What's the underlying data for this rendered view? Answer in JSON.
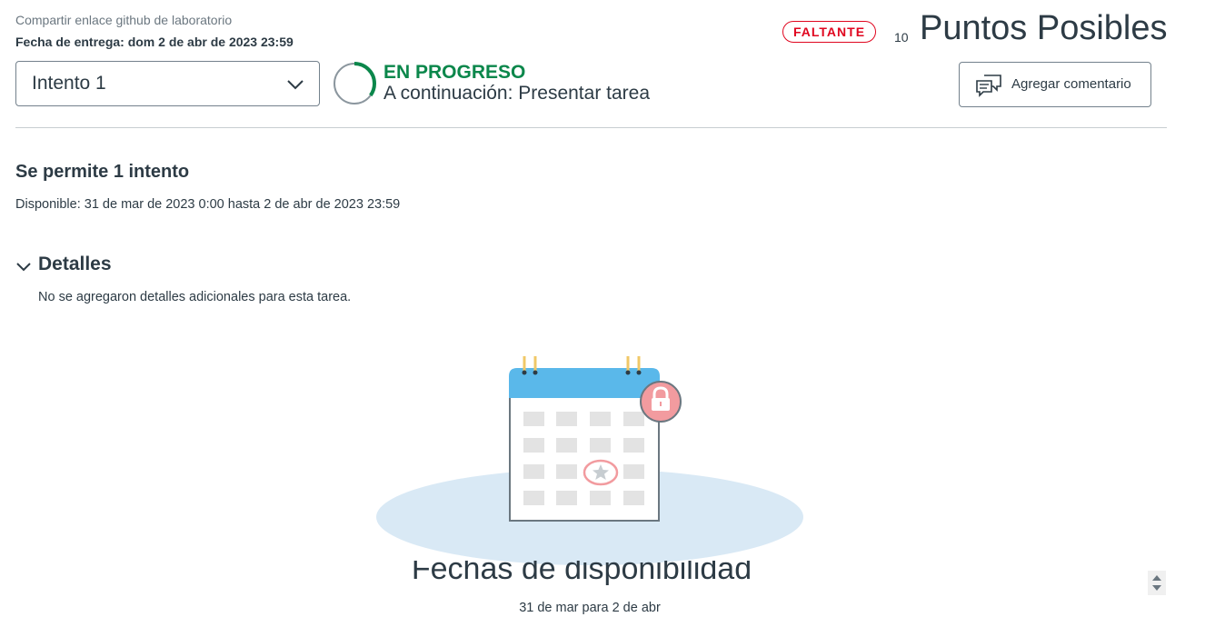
{
  "header": {
    "lab_title": "Compartir enlace github de laboratorio",
    "due_date": "Fecha de entrega: dom 2 de abr de 2023 23:59",
    "missing_badge": "FALTANTE",
    "points_value": "10",
    "points_label": "Puntos Posibles"
  },
  "attempt_select": {
    "value": "Intento 1"
  },
  "status": {
    "title": "EN PROGRESO",
    "next_step": "A continuación: Presentar tarea",
    "progress_fraction": 0.35,
    "color": "#0b874b"
  },
  "comment_button": {
    "label": "Agregar comentario",
    "icon": "comment-icon"
  },
  "attempts": {
    "heading": "Se permite 1 intento",
    "availability": "Disponible: 31 de mar de 2023 0:00 hasta 2 de abr de 2023 23:59"
  },
  "details": {
    "heading": "Detalles",
    "text": "No se agregaron detalles adicionales para esta tarea."
  },
  "availability_dates": {
    "title": "Fechas de disponibilidad",
    "range": "31 de mar para 2 de abr"
  },
  "colors": {
    "missing": "#e0061f",
    "calendar_header": "#5ab8ea",
    "lock_badge": "#f29b9f",
    "platform": "#d9e9f5"
  }
}
